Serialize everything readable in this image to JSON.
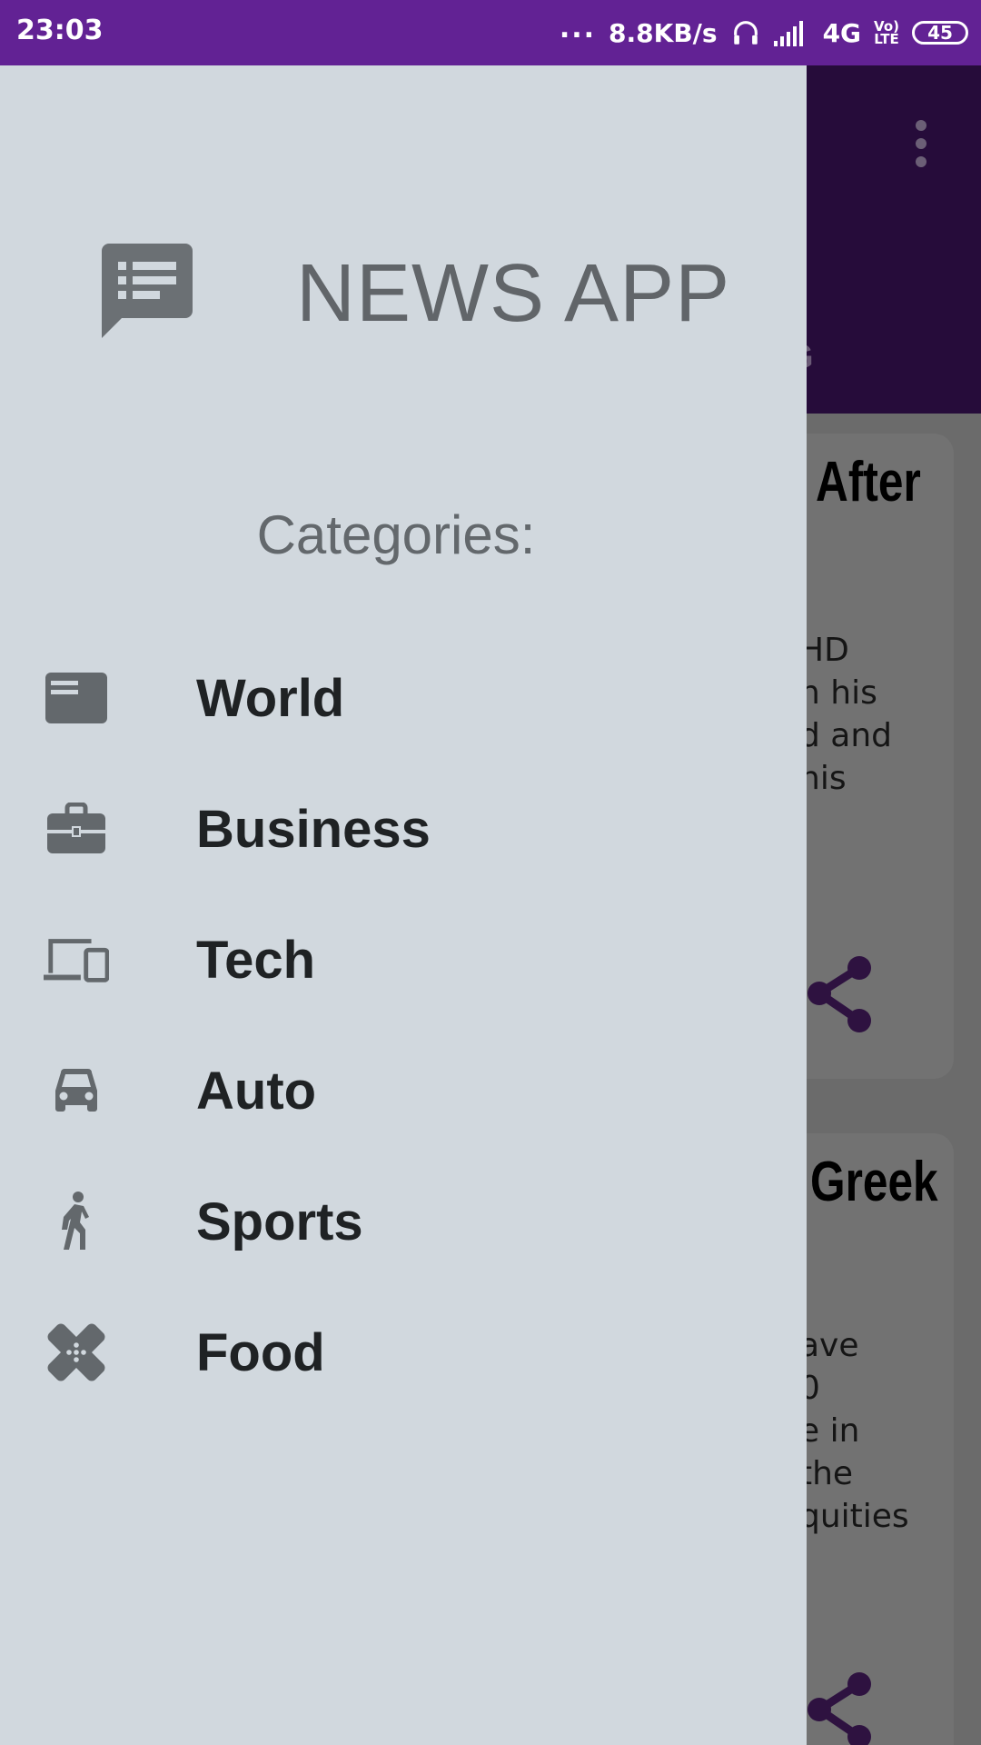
{
  "status_bar": {
    "time": "23:03",
    "dots": "...",
    "speed": "8.8KB/s",
    "network": "4G",
    "volte_top": "Vo)",
    "volte_bottom": "LTE",
    "battery": "45",
    "background_color": "#622294"
  },
  "drawer": {
    "app_title": "NEWS APP",
    "categories_heading": "Categories:",
    "items": [
      {
        "label": "World",
        "icon": "newspaper-icon"
      },
      {
        "label": "Business",
        "icon": "briefcase-icon"
      },
      {
        "label": "Tech",
        "icon": "devices-icon"
      },
      {
        "label": "Auto",
        "icon": "car-icon"
      },
      {
        "label": "Sports",
        "icon": "walking-icon"
      },
      {
        "label": "Food",
        "icon": "bandage-icon"
      }
    ],
    "background_color": "#d1d8de"
  },
  "background_app": {
    "tab_fragment": "G",
    "cards": [
      {
        "title_fragment": "After",
        "text_fragment": "HD\nn his\nd and\nhis"
      },
      {
        "title_fragment": "Greek",
        "text_fragment": "ave\n0\ne in\nthe\nquities"
      }
    ],
    "toolbar_color": "#260c3a",
    "share_icon_color": "#2e1240"
  }
}
